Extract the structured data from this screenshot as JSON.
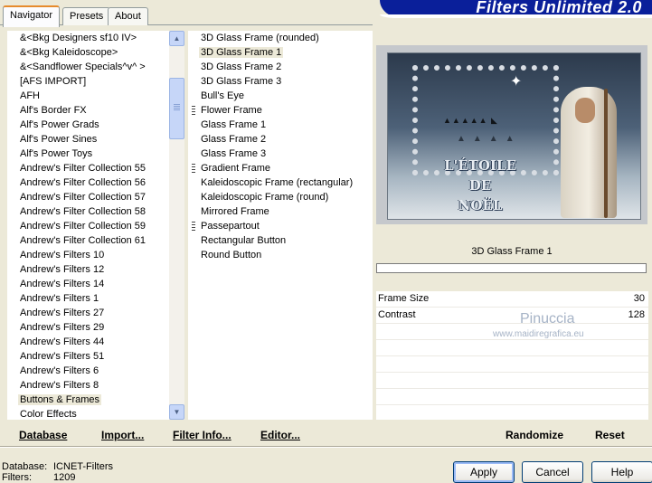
{
  "tabs": [
    {
      "label": "Navigator"
    },
    {
      "label": "Presets"
    },
    {
      "label": "About"
    }
  ],
  "banner": {
    "title": "Filters Unlimited 2.0"
  },
  "categories": [
    {
      "label": "&<Bkg Designers sf10 IV>"
    },
    {
      "label": "&<Bkg Kaleidoscope>"
    },
    {
      "label": "&<Sandflower Specials^v^ >"
    },
    {
      "label": "[AFS IMPORT]"
    },
    {
      "label": "AFH"
    },
    {
      "label": "Alf's Border FX"
    },
    {
      "label": "Alf's Power Grads"
    },
    {
      "label": "Alf's Power Sines"
    },
    {
      "label": "Alf's Power Toys"
    },
    {
      "label": "Andrew's Filter Collection 55"
    },
    {
      "label": "Andrew's Filter Collection 56"
    },
    {
      "label": "Andrew's Filter Collection 57"
    },
    {
      "label": "Andrew's Filter Collection 58"
    },
    {
      "label": "Andrew's Filter Collection 59"
    },
    {
      "label": "Andrew's Filter Collection 61"
    },
    {
      "label": "Andrew's Filters 10"
    },
    {
      "label": "Andrew's Filters 12"
    },
    {
      "label": "Andrew's Filters 14"
    },
    {
      "label": "Andrew's Filters 1"
    },
    {
      "label": "Andrew's Filters 27"
    },
    {
      "label": "Andrew's Filters 29"
    },
    {
      "label": "Andrew's Filters 44"
    },
    {
      "label": "Andrew's Filters 51"
    },
    {
      "label": "Andrew's Filters 6"
    },
    {
      "label": "Andrew's Filters 8"
    },
    {
      "label": "Buttons & Frames",
      "selected": true
    },
    {
      "label": "Color Effects"
    }
  ],
  "filters": [
    {
      "label": "3D Glass Frame (rounded)"
    },
    {
      "label": "3D Glass Frame 1",
      "selected": true
    },
    {
      "label": "3D Glass Frame 2"
    },
    {
      "label": "3D Glass Frame 3"
    },
    {
      "label": "Bull's Eye"
    },
    {
      "label": "Flower Frame",
      "group": true
    },
    {
      "label": "Glass Frame 1"
    },
    {
      "label": "Glass Frame 2"
    },
    {
      "label": "Glass Frame 3"
    },
    {
      "label": "Gradient Frame",
      "group": true
    },
    {
      "label": "Kaleidoscopic Frame (rectangular)"
    },
    {
      "label": "Kaleidoscopic Frame (round)"
    },
    {
      "label": "Mirrored Frame"
    },
    {
      "label": "Passepartout",
      "group": true
    },
    {
      "label": "Rectangular Button"
    },
    {
      "label": "Round Button"
    }
  ],
  "preview": {
    "filter_name": "3D Glass Frame 1",
    "image_text": [
      "L'ÉTOILE",
      "DE",
      "NOËL"
    ],
    "image_credit": "Pinuccia www.maidiregrafica.eu"
  },
  "parameters": [
    {
      "name": "Frame Size",
      "value": "30"
    },
    {
      "name": "Contrast",
      "value": "128"
    }
  ],
  "watermark": {
    "name": "Pinuccia",
    "url": "www.maidiregrafica.eu"
  },
  "toolbar": {
    "database": "Database",
    "import": "Import...",
    "filter_info": "Filter Info...",
    "editor": "Editor...",
    "randomize": "Randomize",
    "reset": "Reset"
  },
  "status": {
    "database_label": "Database:",
    "database_value": "ICNET-Filters",
    "filters_label": "Filters:",
    "filters_value": "1209"
  },
  "buttons": {
    "apply": "Apply",
    "cancel": "Cancel",
    "help": "Help"
  }
}
